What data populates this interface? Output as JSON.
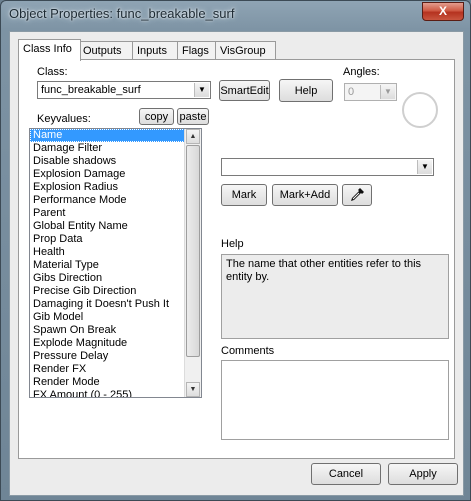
{
  "window": {
    "title": "Object Properties: func_breakable_surf",
    "close_label": "X"
  },
  "tabs": [
    {
      "label": "Class Info",
      "active": true
    },
    {
      "label": "Outputs"
    },
    {
      "label": "Inputs"
    },
    {
      "label": "Flags"
    },
    {
      "label": "VisGroup"
    }
  ],
  "class_section": {
    "label": "Class:",
    "value": "func_breakable_surf",
    "smartedit_label": "SmartEdit",
    "help_label": "Help"
  },
  "angles": {
    "label": "Angles:",
    "value": "0"
  },
  "keyvalues": {
    "label": "Keyvalues:",
    "copy_label": "copy",
    "paste_label": "paste",
    "selected_index": 0,
    "items": [
      "Name",
      "Damage Filter",
      "Disable shadows",
      "Explosion Damage",
      "Explosion Radius",
      "Performance Mode",
      "Parent",
      "Global Entity Name",
      "Prop Data",
      "Health",
      "Material Type",
      "Gibs Direction",
      "Precise Gib Direction",
      "Damaging it Doesn't Push It",
      "Gib Model",
      "Spawn On Break",
      "Explode Magnitude",
      "Pressure Delay",
      "Render FX",
      "Render Mode",
      "FX Amount (0 - 255)"
    ]
  },
  "value_field": {
    "value": ""
  },
  "mark_label": "Mark",
  "mark_add_label": "Mark+Add",
  "help_section": {
    "label": "Help",
    "text": "The name that other entities refer to this entity by."
  },
  "comments_section": {
    "label": "Comments",
    "value": ""
  },
  "footer": {
    "cancel_label": "Cancel",
    "apply_label": "Apply"
  },
  "colors": {
    "selection": "#3399ff",
    "close_button": "#c9553f"
  },
  "icons": {
    "eyedropper": "eyedropper-icon",
    "close": "close-icon"
  }
}
